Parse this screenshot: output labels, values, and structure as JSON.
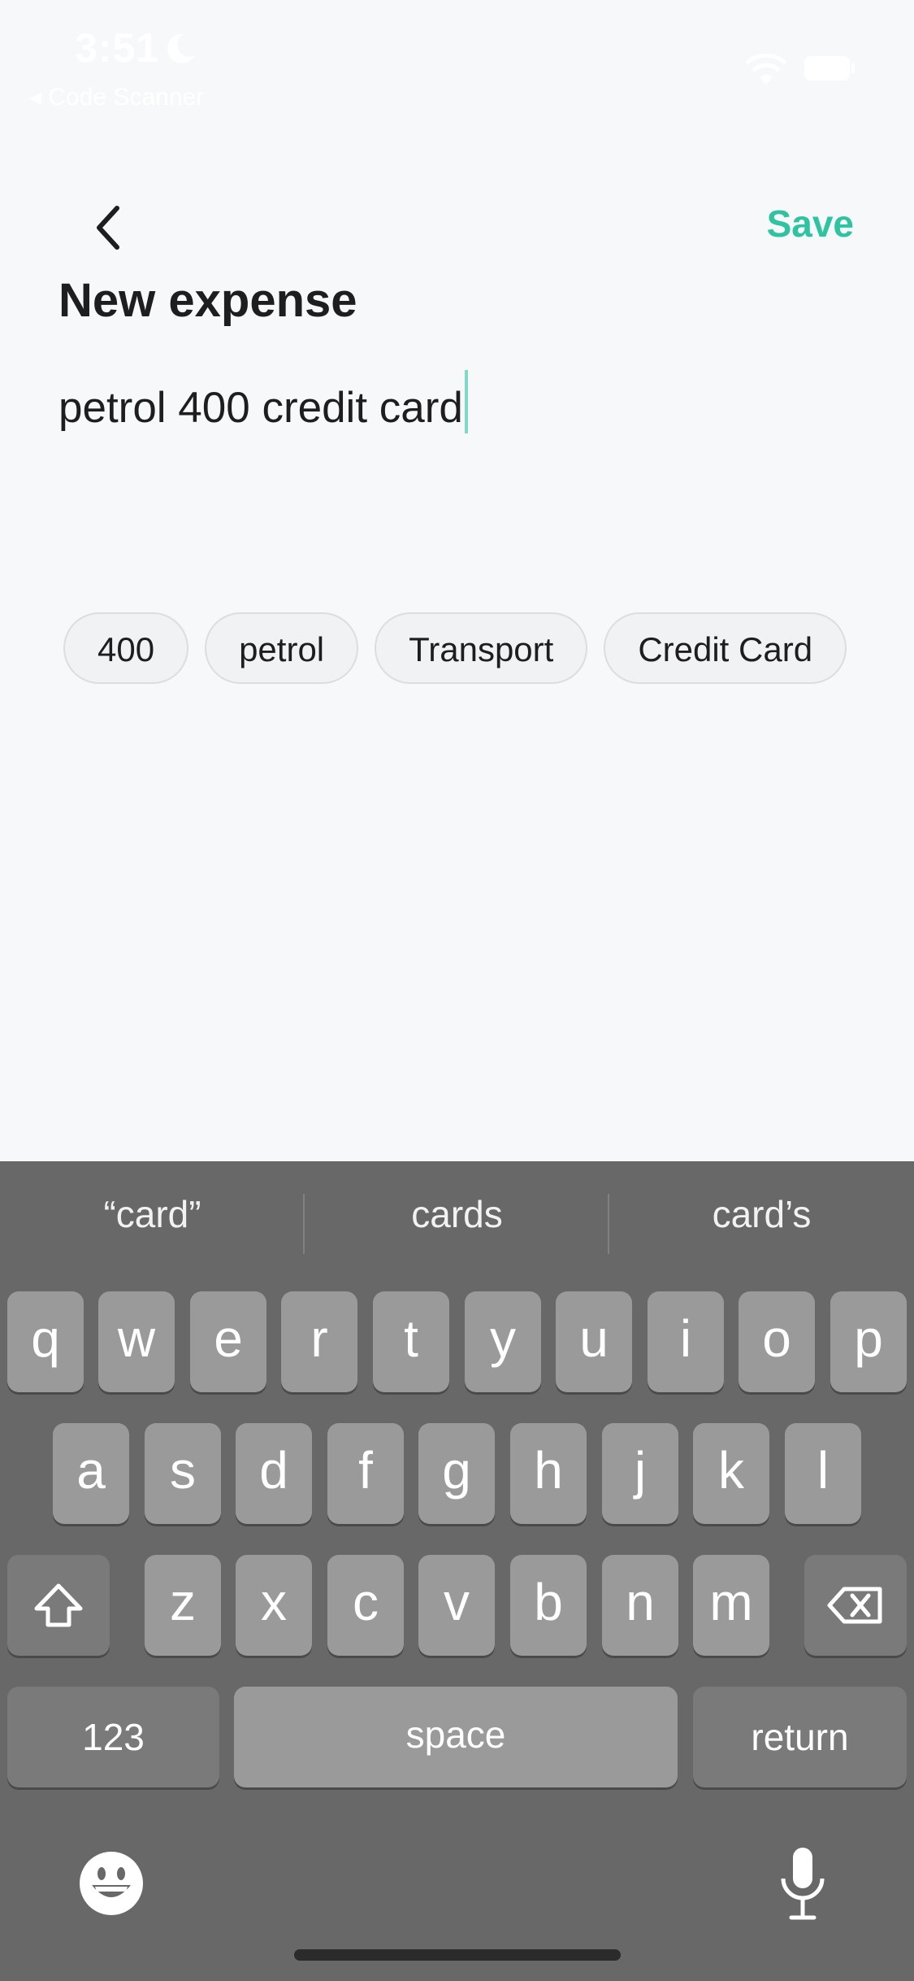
{
  "status_bar": {
    "time": "3:51",
    "back_app": "◂ Code Scanner"
  },
  "nav": {
    "save_label": "Save"
  },
  "page": {
    "title": "New expense",
    "entry_text": "petrol 400 credit card"
  },
  "chips": [
    "400",
    "petrol",
    "Transport",
    "Credit Card"
  ],
  "keyboard": {
    "suggestions": [
      "“card”",
      "cards",
      "card’s"
    ],
    "row1": [
      "q",
      "w",
      "e",
      "r",
      "t",
      "y",
      "u",
      "i",
      "o",
      "p"
    ],
    "row2": [
      "a",
      "s",
      "d",
      "f",
      "g",
      "h",
      "j",
      "k",
      "l"
    ],
    "row3": [
      "z",
      "x",
      "c",
      "v",
      "b",
      "n",
      "m"
    ],
    "numbers_label": "123",
    "space_label": "space",
    "return_label": "return"
  },
  "colors": {
    "accent": "#2ec4a2",
    "background": "#f7f8fa",
    "keyboard_bg": "#686868"
  }
}
